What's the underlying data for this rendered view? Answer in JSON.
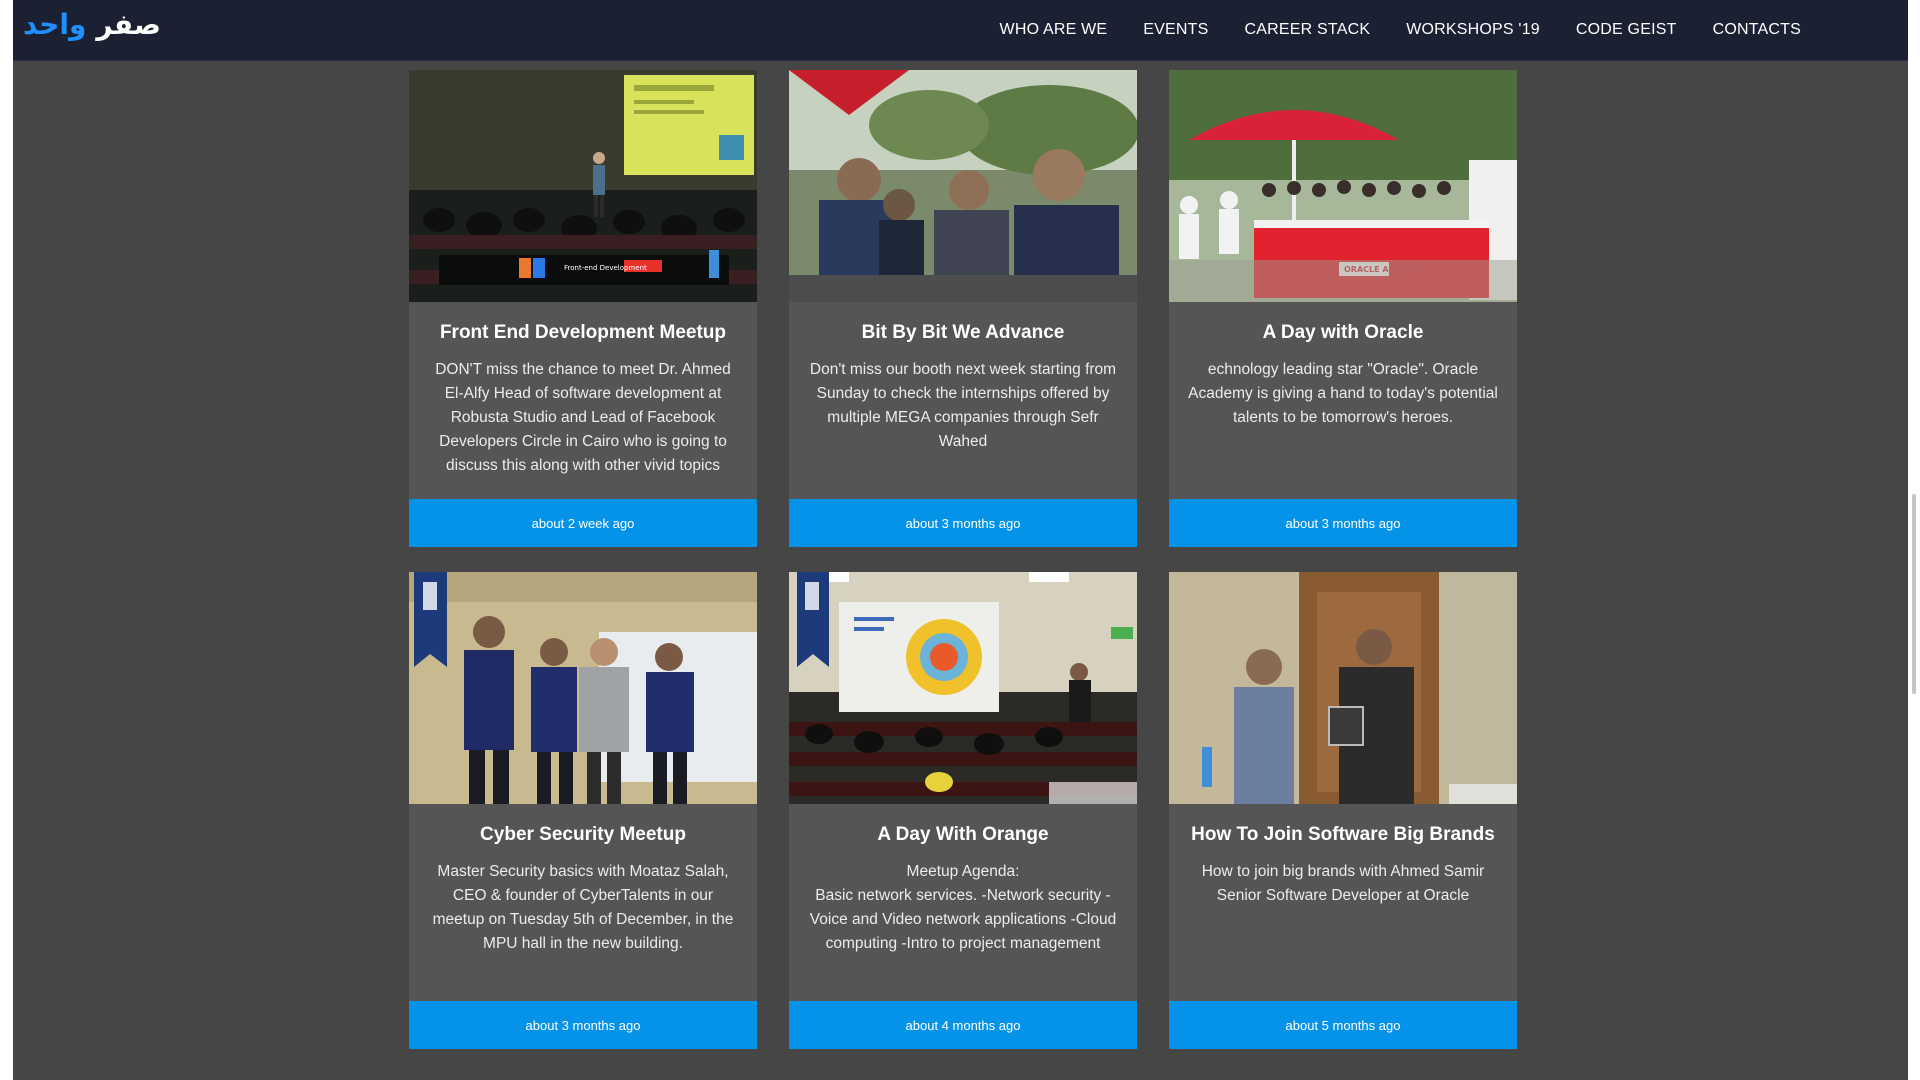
{
  "nav": {
    "logo_part1": "صفر",
    "logo_part2": "واحد",
    "links": [
      {
        "label": "WHO ARE WE"
      },
      {
        "label": "EVENTS"
      },
      {
        "label": "CAREER STACK"
      },
      {
        "label": "WORKSHOPS '19"
      },
      {
        "label": "CODE GEIST"
      },
      {
        "label": "CONTACTS"
      }
    ]
  },
  "events": [
    {
      "title": "Front End Development Meetup",
      "description": "DON'T miss the chance to meet Dr. Ahmed El-Alfy Head of software development at Robusta Studio and Lead of Facebook Developers Circle in Cairo who is going to discuss this along with other vivid topics",
      "time": "about 2 week ago",
      "image_text": "Front-end Development"
    },
    {
      "title": "Bit By Bit We Advance",
      "description": "Don't miss our booth next week starting from Sunday to check the internships offered by multiple MEGA companies through Sefr Wahed",
      "time": "about 3 months ago"
    },
    {
      "title": "A Day with Oracle",
      "description": "echnology leading star \"Oracle\". Oracle Academy is giving a hand to today's potential talents to be tomorrow's heroes.",
      "time": "about 3 months ago",
      "image_text": "ORACLE ACADEMY"
    },
    {
      "title": "Cyber Security Meetup",
      "description": "Master Security basics with Moataz Salah, CEO & founder of CyberTalents in our meetup on Tuesday 5th of December, in the MPU hall in the new building.",
      "time": "about 3 months ago"
    },
    {
      "title": "A Day With Orange",
      "description": "Meetup Agenda:\nBasic network services. -Network security -Voice and Video network applications -Cloud computing -Intro to project management",
      "time": "about 4 months ago"
    },
    {
      "title": "How To Join Software Big Brands",
      "description": "How to join big brands with Ahmed Samir Senior Software Developer at Oracle",
      "time": "about 5 months ago"
    }
  ]
}
